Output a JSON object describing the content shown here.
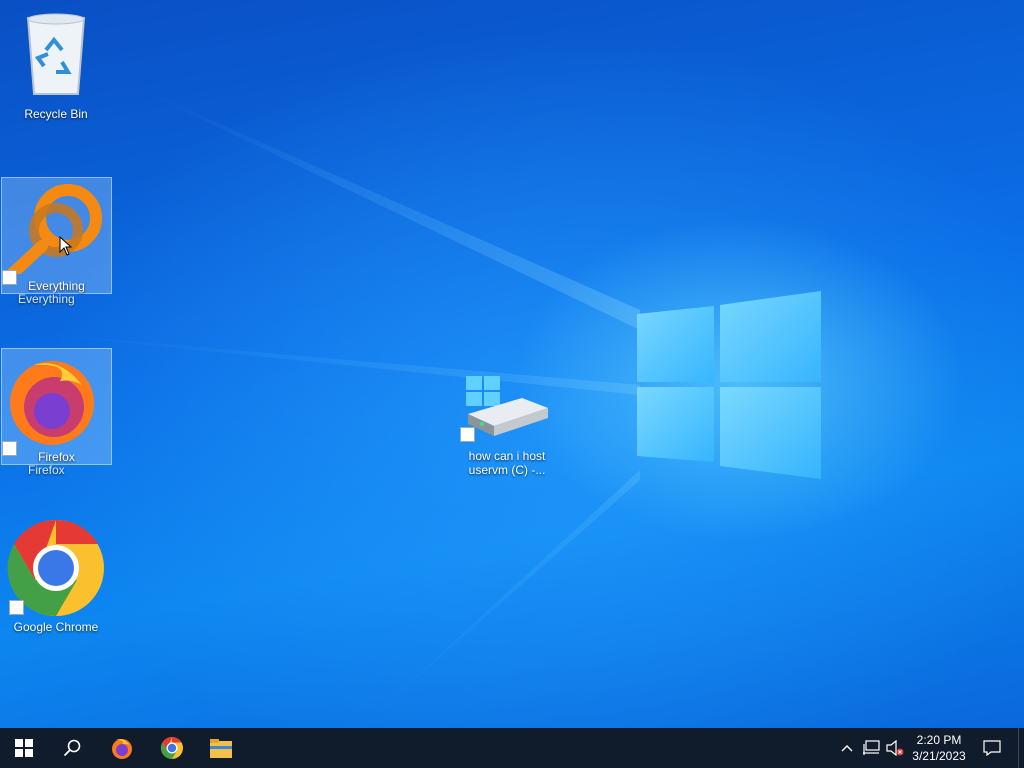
{
  "desktop": {
    "icons": [
      {
        "name": "recycle-bin",
        "label": "Recycle Bin"
      },
      {
        "name": "everything",
        "label": "Everything",
        "drag_label": "Everything"
      },
      {
        "name": "firefox",
        "label": "Firefox",
        "drag_label": "Firefox"
      },
      {
        "name": "google-chrome",
        "label": "Google Chrome"
      },
      {
        "name": "drive-shortcut",
        "label": "how can i host uservm (C) -..."
      }
    ]
  },
  "taskbar": {
    "pinned": [
      "start-icon",
      "search-icon",
      "firefox-icon",
      "chrome-icon",
      "file-explorer-icon"
    ],
    "tray": {
      "icons": [
        "chevron-up-icon",
        "network-icon",
        "volume-muted-icon",
        "notification-icon"
      ],
      "time": "2:20 PM",
      "date": "3/21/2023"
    }
  },
  "colors": {
    "taskbar": "#101c2c",
    "wallpaper_blue": "#0b6ee6"
  }
}
